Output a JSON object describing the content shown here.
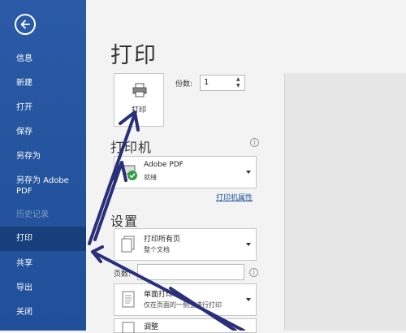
{
  "sidebar": {
    "items": [
      {
        "label": "信息"
      },
      {
        "label": "新建"
      },
      {
        "label": "打开"
      },
      {
        "label": "保存"
      },
      {
        "label": "另存为"
      },
      {
        "label": "另存为 Adobe PDF"
      },
      {
        "label": "历史记录"
      },
      {
        "label": "打印"
      },
      {
        "label": "共享"
      },
      {
        "label": "导出"
      },
      {
        "label": "关闭"
      }
    ],
    "active": "打印"
  },
  "main": {
    "title": "打印",
    "print_button_label": "打印",
    "copies_label": "份数:",
    "copies_value": "1",
    "printer_section_title": "打印机",
    "printer": {
      "name": "Adobe PDF",
      "status": "就绪"
    },
    "printer_properties_link": "打印机属性",
    "settings_section_title": "设置",
    "print_range": {
      "title": "打印所有页",
      "subtitle": "整个文档"
    },
    "pages_label": "页数:",
    "pages_value": "",
    "sides": {
      "title": "单面打印",
      "subtitle": "仅在页面的一侧上进行打印"
    },
    "scaling": {
      "title": "调整"
    }
  },
  "colors": {
    "sidebar_bg": "#2b5aa6",
    "sidebar_active": "#163f7c",
    "annotation_arrow": "#2a2f7a"
  }
}
